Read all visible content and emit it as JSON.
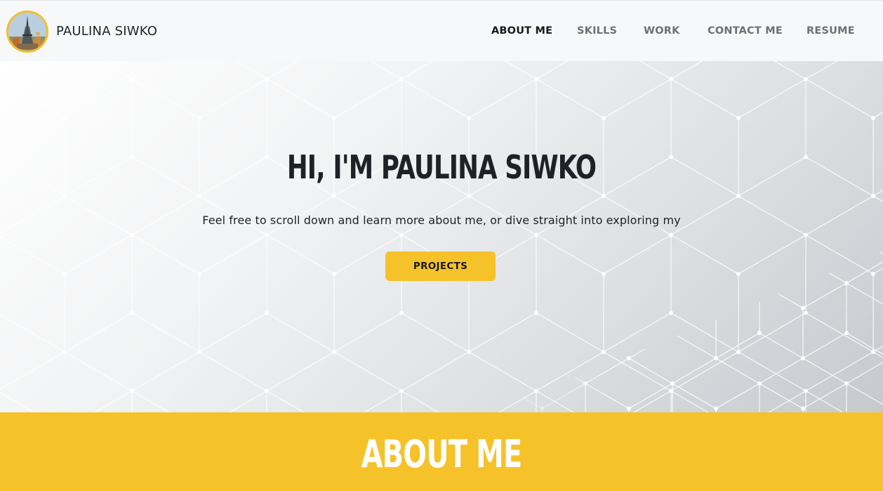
{
  "header": {
    "brand_name": "PAULINA SIWKO",
    "avatar_icon": "profile-photo-eiffel-tower",
    "nav": [
      {
        "label": "ABOUT ME",
        "active": true
      },
      {
        "label": "SKILLS",
        "active": false
      },
      {
        "label": "WORK",
        "active": false
      },
      {
        "label": "CONTACT ME",
        "active": false
      },
      {
        "label": "RESUME",
        "active": false
      }
    ]
  },
  "hero": {
    "title": "HI, I'M PAULINA SIWKO",
    "subtitle": "Feel free to scroll down and learn more about me, or dive straight into exploring my",
    "button_label": "PROJECTS",
    "background_pattern": "hexagon-network"
  },
  "about": {
    "title": "ABOUT ME"
  },
  "colors": {
    "accent": "#f6c22a",
    "text_dark": "#1e2226",
    "nav_inactive": "#6c7176",
    "navbar_bg": "#f7f8f9"
  }
}
